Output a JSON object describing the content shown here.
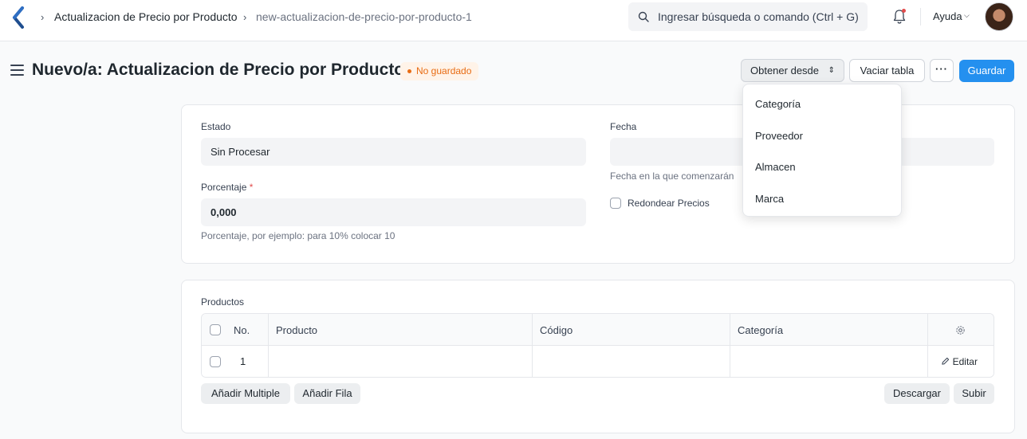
{
  "breadcrumbs": [
    "Actualizacion de Precio por Producto",
    "new-actualizacion-de-precio-por-producto-1"
  ],
  "search": {
    "placeholder": "Ingresar búsqueda o comando (Ctrl + G)"
  },
  "navbar": {
    "help_label": "Ayuda"
  },
  "page": {
    "title": "Nuevo/a: Actualizacion de Precio por Producto",
    "status_badge": "No guardado"
  },
  "toolbar": {
    "get_from_label": "Obtener desde",
    "clear_table_label": "Vaciar tabla",
    "more_label": "···",
    "save_label": "Guardar"
  },
  "dropdown": {
    "items": [
      "Categoría",
      "Proveedor",
      "Almacen",
      "Marca"
    ]
  },
  "form": {
    "estado_label": "Estado",
    "estado_value": "Sin Procesar",
    "fecha_label": "Fecha",
    "fecha_value": "",
    "fecha_help": "Fecha en la que comenzarán",
    "porcentaje_label": "Porcentaje",
    "porcentaje_required": "*",
    "porcentaje_value": "0,000",
    "porcentaje_help": "Porcentaje, por ejemplo: para 10% colocar 10",
    "redondear_label": "Redondear Precios"
  },
  "products": {
    "section_label": "Productos",
    "columns": [
      "No.",
      "Producto",
      "Código",
      "Categoría"
    ],
    "rows": [
      {
        "no": "1",
        "producto": "",
        "codigo": "",
        "categoria": ""
      }
    ],
    "edit_label": "Editar",
    "add_multiple_label": "Añadir Multiple",
    "add_row_label": "Añadir Fila",
    "download_label": "Descargar",
    "upload_label": "Subir"
  },
  "colors": {
    "primary": "#2490ef",
    "warning": "#e86c13",
    "background": "#f9fafb"
  }
}
